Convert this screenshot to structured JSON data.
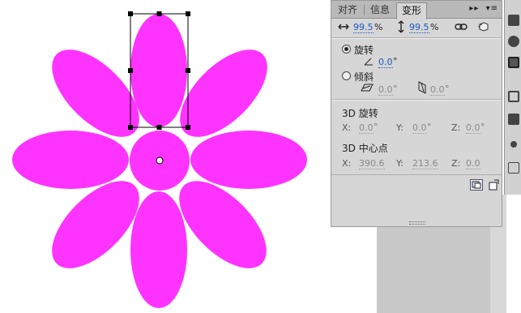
{
  "panel": {
    "tabs": [
      "对齐",
      "信息",
      "变形"
    ],
    "active_tab": "变形",
    "scale_w": "99.5",
    "scale_h": "99.5",
    "pct": "%",
    "rotate_label": "旋转",
    "rotate_value": "0.0",
    "skew_label": "倾斜",
    "skew_h": "0.0",
    "skew_v": "0.0",
    "deg": "°",
    "rot3d_title": "3D 旋转",
    "rot3d_x_label": "X:",
    "rot3d_x": "0.0",
    "rot3d_y_label": "Y:",
    "rot3d_y": "0.0",
    "rot3d_z_label": "Z:",
    "rot3d_z": "0.0",
    "center3d_title": "3D 中心点",
    "c3d_x_label": "X:",
    "c3d_x": "390.6",
    "c3d_y_label": "Y:",
    "c3d_y": "213.6",
    "c3d_z_label": "Z:",
    "c3d_z": "0.0"
  },
  "colors": {
    "petal": "#ff33ff",
    "panel_bg": "#d6d6d6",
    "link": "#1a56c4"
  }
}
